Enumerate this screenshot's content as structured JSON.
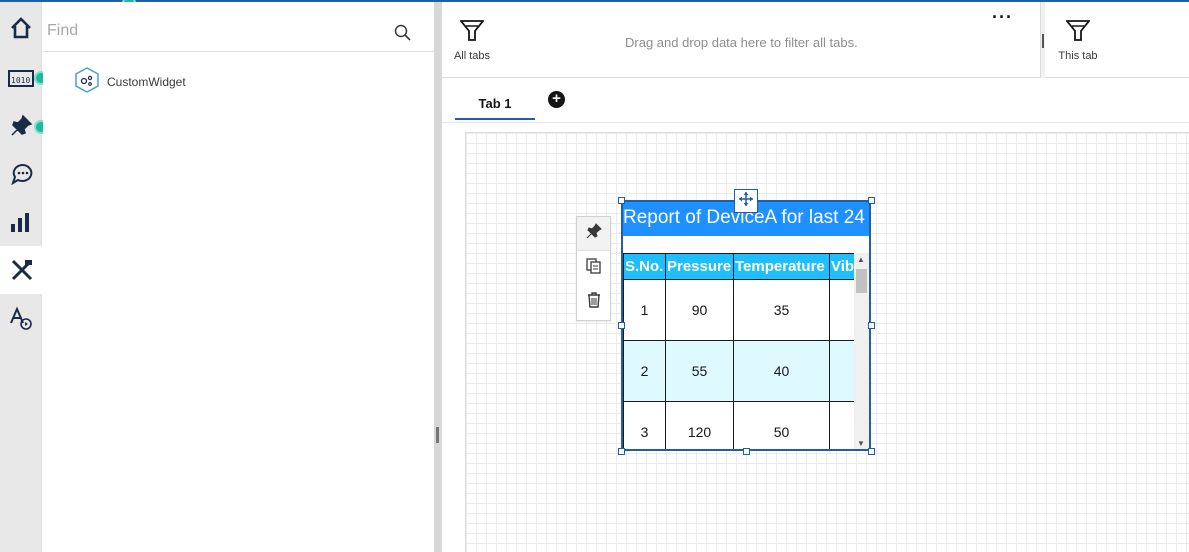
{
  "rail": {
    "items": [
      {
        "name": "home-icon"
      },
      {
        "name": "data-source-icon"
      },
      {
        "name": "pin-icon"
      },
      {
        "name": "conversation-icon"
      },
      {
        "name": "chart-icon"
      },
      {
        "name": "tools-icon"
      },
      {
        "name": "text-style-icon"
      }
    ]
  },
  "panel": {
    "find_placeholder": "Find",
    "widget_label": "CustomWidget"
  },
  "filter_bar": {
    "all_tabs_label": "All tabs",
    "drop_hint": "Drag and drop data here to filter all tabs.",
    "more_label": "···",
    "this_tab_label": "This tab"
  },
  "tabs": {
    "items": [
      {
        "label": "Tab 1"
      }
    ],
    "add_label": "+"
  },
  "widget": {
    "title": "Report of DeviceA for last 24",
    "columns": [
      "S.No.",
      "Pressure",
      "Temperature",
      "Vib"
    ],
    "rows": [
      [
        "1",
        "90",
        "35",
        ""
      ],
      [
        "2",
        "55",
        "40",
        ""
      ],
      [
        "3",
        "120",
        "50",
        ""
      ]
    ]
  },
  "colors": {
    "accent": "#1f5ea8",
    "title_bg": "#1e90ff",
    "header_bg": "#1fbfff",
    "alt_row": "#dffaff",
    "badge": "#1bbc9b"
  }
}
